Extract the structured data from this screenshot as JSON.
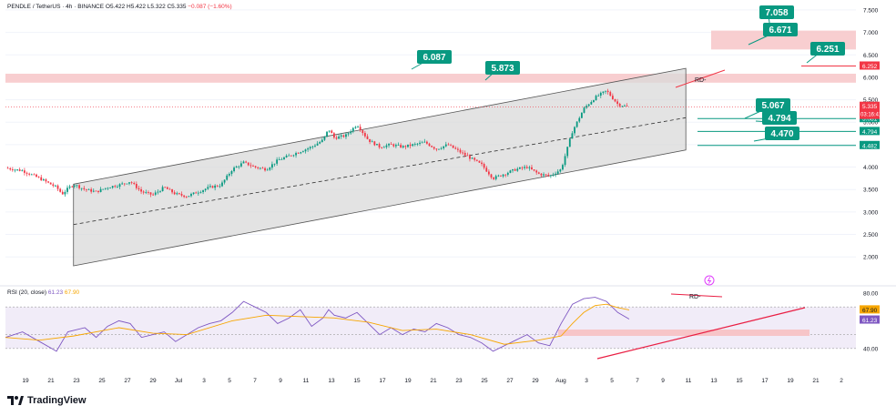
{
  "header": {
    "symbol": "PENDLE / TetherUS · 4h · BINANCE",
    "ohlc": "O5.422 H5.422 L5.322 C5.335",
    "change": "−0.087 (−1.60%)"
  },
  "rsi_header": {
    "label": "RSI (20, close)",
    "rsi": "61.23",
    "ma": "67.90"
  },
  "footer": {
    "brand": "TradingView"
  },
  "colors": {
    "up": "#089981",
    "down": "#f23645",
    "channel_fill": "#d9d9d9",
    "zone": "#f7c5c8",
    "callout": "#089981",
    "rsi_line": "#7e57c2",
    "rsi_ma": "#f7a600",
    "rsi_band": "#ede7f6",
    "trend": "#e91e43"
  },
  "chart_data": [
    {
      "type": "candlestick",
      "title": "PENDLE / TetherUS · 4h · BINANCE",
      "x_ticks": [
        "19",
        "21",
        "23",
        "25",
        "27",
        "29",
        "Jul",
        "3",
        "5",
        "7",
        "9",
        "11",
        "13",
        "15",
        "17",
        "19",
        "21",
        "23",
        "25",
        "27",
        "29",
        "Aug",
        "3",
        "5",
        "7",
        "9",
        "11",
        "13",
        "15",
        "17",
        "19",
        "21",
        "2"
      ],
      "y_ticks": [
        "7.500",
        "7.000",
        "6.500",
        "6.000",
        "5.500",
        "5.000",
        "4.500",
        "4.000",
        "3.500",
        "3.000",
        "2.500",
        "2.000"
      ],
      "ylim": [
        1.7,
        7.6
      ],
      "price_path": [
        [
          0,
          3.98
        ],
        [
          3,
          3.92
        ],
        [
          6,
          3.75
        ],
        [
          9,
          3.55
        ],
        [
          10,
          3.4
        ],
        [
          11,
          3.52
        ],
        [
          12,
          3.62
        ],
        [
          14,
          3.5
        ],
        [
          16,
          3.45
        ],
        [
          18,
          3.55
        ],
        [
          20,
          3.6
        ],
        [
          22,
          3.68
        ],
        [
          24,
          3.45
        ],
        [
          26,
          3.38
        ],
        [
          28,
          3.55
        ],
        [
          30,
          3.4
        ],
        [
          32,
          3.35
        ],
        [
          34,
          3.45
        ],
        [
          36,
          3.55
        ],
        [
          38,
          3.6
        ],
        [
          40,
          3.95
        ],
        [
          42,
          4.1
        ],
        [
          44,
          4.0
        ],
        [
          46,
          3.95
        ],
        [
          48,
          4.15
        ],
        [
          50,
          4.25
        ],
        [
          52,
          4.35
        ],
        [
          54,
          4.45
        ],
        [
          56,
          4.6
        ],
        [
          57,
          4.85
        ],
        [
          58,
          4.65
        ],
        [
          60,
          4.7
        ],
        [
          62,
          4.95
        ],
        [
          64,
          4.6
        ],
        [
          66,
          4.45
        ],
        [
          68,
          4.5
        ],
        [
          70,
          4.45
        ],
        [
          72,
          4.5
        ],
        [
          74,
          4.55
        ],
        [
          76,
          4.4
        ],
        [
          78,
          4.5
        ],
        [
          80,
          4.35
        ],
        [
          82,
          4.2
        ],
        [
          84,
          4.05
        ],
        [
          86,
          3.75
        ],
        [
          88,
          3.85
        ],
        [
          90,
          3.95
        ],
        [
          92,
          4.0
        ],
        [
          94,
          3.85
        ],
        [
          96,
          3.8
        ],
        [
          98,
          3.95
        ],
        [
          100,
          4.8
        ],
        [
          102,
          5.3
        ],
        [
          104,
          5.55
        ],
        [
          106,
          5.7
        ],
        [
          107,
          5.55
        ],
        [
          108,
          5.4
        ],
        [
          110,
          5.335
        ]
      ],
      "price_label": "5.335",
      "countdown": "03:16:41",
      "axis_labels": [
        {
          "text": "6.252",
          "kind": "zone"
        },
        {
          "text": "5.081",
          "kind": "level"
        },
        {
          "text": "4.794",
          "kind": "level"
        },
        {
          "text": "4.482",
          "kind": "level"
        }
      ],
      "resistance_zones": [
        [
          5.88,
          6.08
        ],
        [
          6.62,
          7.04
        ]
      ],
      "level_lines": [
        5.081,
        4.794,
        4.482
      ],
      "level_6252": 6.252,
      "channel": {
        "x": [
          12,
          120
        ],
        "upper": [
          3.62,
          6.2
        ],
        "lower": [
          1.8,
          4.38
        ],
        "middle": [
          2.72,
          5.1
        ]
      },
      "callouts": [
        "7.058",
        "6.671",
        "6.251",
        "6.087",
        "5.873",
        "5.067",
        "4.794",
        "4.470"
      ],
      "annotations": [
        "RD-"
      ]
    },
    {
      "type": "line",
      "title": "RSI (20, close)",
      "ylim": [
        30,
        80
      ],
      "y_ticks": [
        "80.00",
        "40.00"
      ],
      "rsi_labels": [
        "67.90",
        "61.23"
      ],
      "rsi_path": [
        [
          0,
          48
        ],
        [
          3,
          52
        ],
        [
          6,
          45
        ],
        [
          9,
          38
        ],
        [
          11,
          52
        ],
        [
          14,
          55
        ],
        [
          16,
          48
        ],
        [
          18,
          56
        ],
        [
          20,
          60
        ],
        [
          22,
          58
        ],
        [
          24,
          48
        ],
        [
          26,
          50
        ],
        [
          28,
          52
        ],
        [
          30,
          45
        ],
        [
          32,
          50
        ],
        [
          34,
          55
        ],
        [
          36,
          58
        ],
        [
          38,
          60
        ],
        [
          40,
          66
        ],
        [
          42,
          74
        ],
        [
          44,
          70
        ],
        [
          46,
          66
        ],
        [
          48,
          58
        ],
        [
          50,
          62
        ],
        [
          52,
          68
        ],
        [
          54,
          56
        ],
        [
          56,
          62
        ],
        [
          57,
          68
        ],
        [
          58,
          64
        ],
        [
          60,
          62
        ],
        [
          62,
          66
        ],
        [
          64,
          58
        ],
        [
          66,
          50
        ],
        [
          68,
          55
        ],
        [
          70,
          50
        ],
        [
          72,
          54
        ],
        [
          74,
          52
        ],
        [
          76,
          58
        ],
        [
          78,
          55
        ],
        [
          80,
          50
        ],
        [
          82,
          48
        ],
        [
          84,
          44
        ],
        [
          86,
          38
        ],
        [
          88,
          42
        ],
        [
          90,
          46
        ],
        [
          92,
          50
        ],
        [
          94,
          44
        ],
        [
          96,
          42
        ],
        [
          98,
          58
        ],
        [
          100,
          72
        ],
        [
          102,
          76
        ],
        [
          104,
          77
        ],
        [
          106,
          74
        ],
        [
          107,
          70
        ],
        [
          108,
          66
        ],
        [
          110,
          61.23
        ]
      ],
      "rsi_ma_path": [
        [
          0,
          48
        ],
        [
          6,
          46
        ],
        [
          12,
          49
        ],
        [
          20,
          55
        ],
        [
          26,
          51
        ],
        [
          32,
          50
        ],
        [
          40,
          60
        ],
        [
          46,
          64
        ],
        [
          52,
          63
        ],
        [
          58,
          62
        ],
        [
          64,
          59
        ],
        [
          70,
          53
        ],
        [
          76,
          54
        ],
        [
          82,
          50
        ],
        [
          88,
          43
        ],
        [
          94,
          46
        ],
        [
          98,
          49
        ],
        [
          100,
          58
        ],
        [
          102,
          66
        ],
        [
          104,
          71
        ],
        [
          106,
          72
        ],
        [
          108,
          69.5
        ],
        [
          110,
          67.9
        ]
      ],
      "band": [
        40,
        70
      ],
      "annotations": [
        "RD-"
      ]
    }
  ]
}
